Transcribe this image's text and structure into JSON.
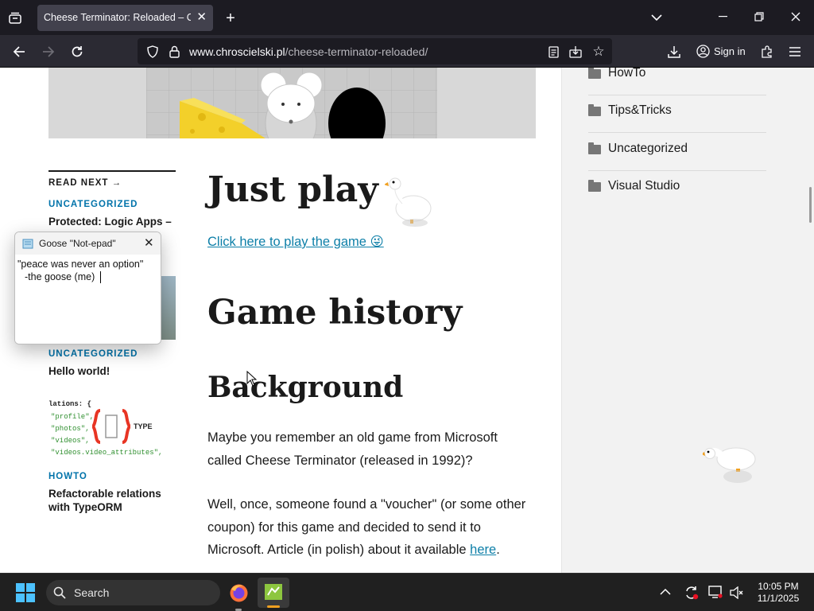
{
  "browser": {
    "tab_title": "Cheese Terminator: Reloaded – Chroscielski",
    "url_domain": "www.chroscielski.pl",
    "url_path": "/cheese-terminator-reloaded/",
    "sign_in_label": "Sign in"
  },
  "sidebar": {
    "categories": [
      "HowTo",
      "Tips&Tricks",
      "Uncategorized",
      "Visual Studio"
    ]
  },
  "read_next": {
    "heading": "READ NEXT →",
    "posts": [
      {
        "category": "UNCATEGORIZED",
        "title": "Protected: Logic Apps –"
      },
      {
        "category": "UNCATEGORIZED",
        "title": "Hello world!"
      },
      {
        "category": "HOWTO",
        "title": "Refactorable relations with TypeORM"
      }
    ],
    "code_thumb": {
      "lines": [
        "lations: {",
        "\"profile\",",
        "\"photos\",",
        "\"videos\",",
        "\"videos.video_attributes\","
      ],
      "logo": "TYPE"
    }
  },
  "article": {
    "h1": "Just play",
    "play_link": "Click here to play the game",
    "play_emoji": "😜",
    "h2": "Game history",
    "h3": "Background",
    "para1": "Maybe you remember an old game from Microsoft called Cheese Terminator (released in 1992)?",
    "para2": "Well, once, someone found a \"voucher\" (or some other coupon) for this game and decided to send it to Microsoft. Article (in polish) about it available ",
    "para2_link": "here",
    "para2_end": "."
  },
  "notepad": {
    "title": "Goose \"Not-epad\"",
    "line1": "\"peace was never an option\"",
    "line2": "-the goose (me)"
  },
  "taskbar": {
    "search_label": "Search",
    "time": "10:05 PM",
    "date": "11/1/2025"
  },
  "colors": {
    "link": "#0d7fa8",
    "kicker": "#0073aa",
    "firefox_chrome": "#1c1b22",
    "taskbar": "#202020"
  }
}
